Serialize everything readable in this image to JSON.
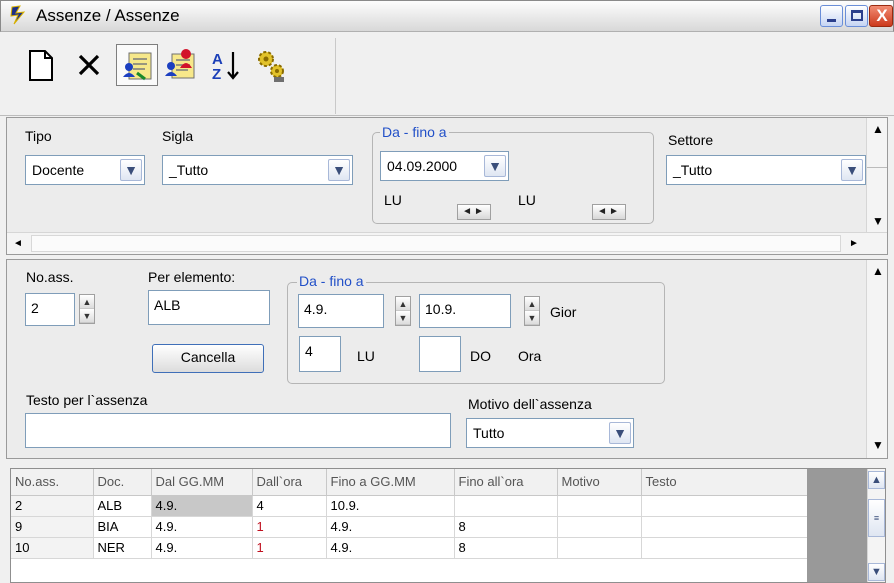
{
  "window": {
    "title": "Assenze / Assenze",
    "controls": {
      "minimize": "_",
      "maximize": "□",
      "close": "X"
    }
  },
  "toolbar": {
    "icons": [
      "new-document-icon",
      "delete-icon",
      "absence-view-icon",
      "absence-entry-icon",
      "sort-az-icon",
      "settings-icon"
    ],
    "delete_glyph": "✕"
  },
  "filter": {
    "tipo_label": "Tipo",
    "tipo_value": "Docente",
    "sigla_label": "Sigla",
    "sigla_value": "_Tutto",
    "range_legend": "Da - fino a",
    "date_value": "04.09.2000",
    "day_from": "LU",
    "day_to": "LU",
    "settore_label": "Settore",
    "settore_value": "_Tutto"
  },
  "form": {
    "noass_label": "No.ass.",
    "noass_value": "2",
    "per_elemento_label": "Per elemento:",
    "per_elemento_value": "ALB",
    "cancella_label": "Cancella",
    "range_legend": "Da - fino a",
    "from_date": "4.9.",
    "to_date": "10.9.",
    "gior_label": "Gior",
    "from_hour": "4",
    "from_day": "LU",
    "to_hour": "",
    "to_day": "DO",
    "ora_label": "Ora",
    "testo_label": "Testo per l`assenza",
    "testo_value": "",
    "motivo_label": "Motivo dell`assenza",
    "motivo_value": "Tutto"
  },
  "grid": {
    "columns": [
      "No.ass.",
      "Doc.",
      "Dal GG.MM",
      "Dall`ora",
      "Fino a GG.MM",
      "Fino all`ora",
      "Motivo",
      "Testo"
    ],
    "rows": [
      [
        "2",
        "ALB",
        "4.9.",
        "4",
        "10.9.",
        "",
        "",
        ""
      ],
      [
        "9",
        "BIA",
        "4.9.",
        "1",
        "4.9.",
        "8",
        "",
        ""
      ],
      [
        "10",
        "NER",
        "4.9.",
        "1",
        "4.9.",
        "8",
        "",
        ""
      ]
    ]
  },
  "colors": {
    "legend_blue": "#2250c8",
    "hour_red": "#c0101f",
    "selected_cell": "#c8c8c8"
  }
}
